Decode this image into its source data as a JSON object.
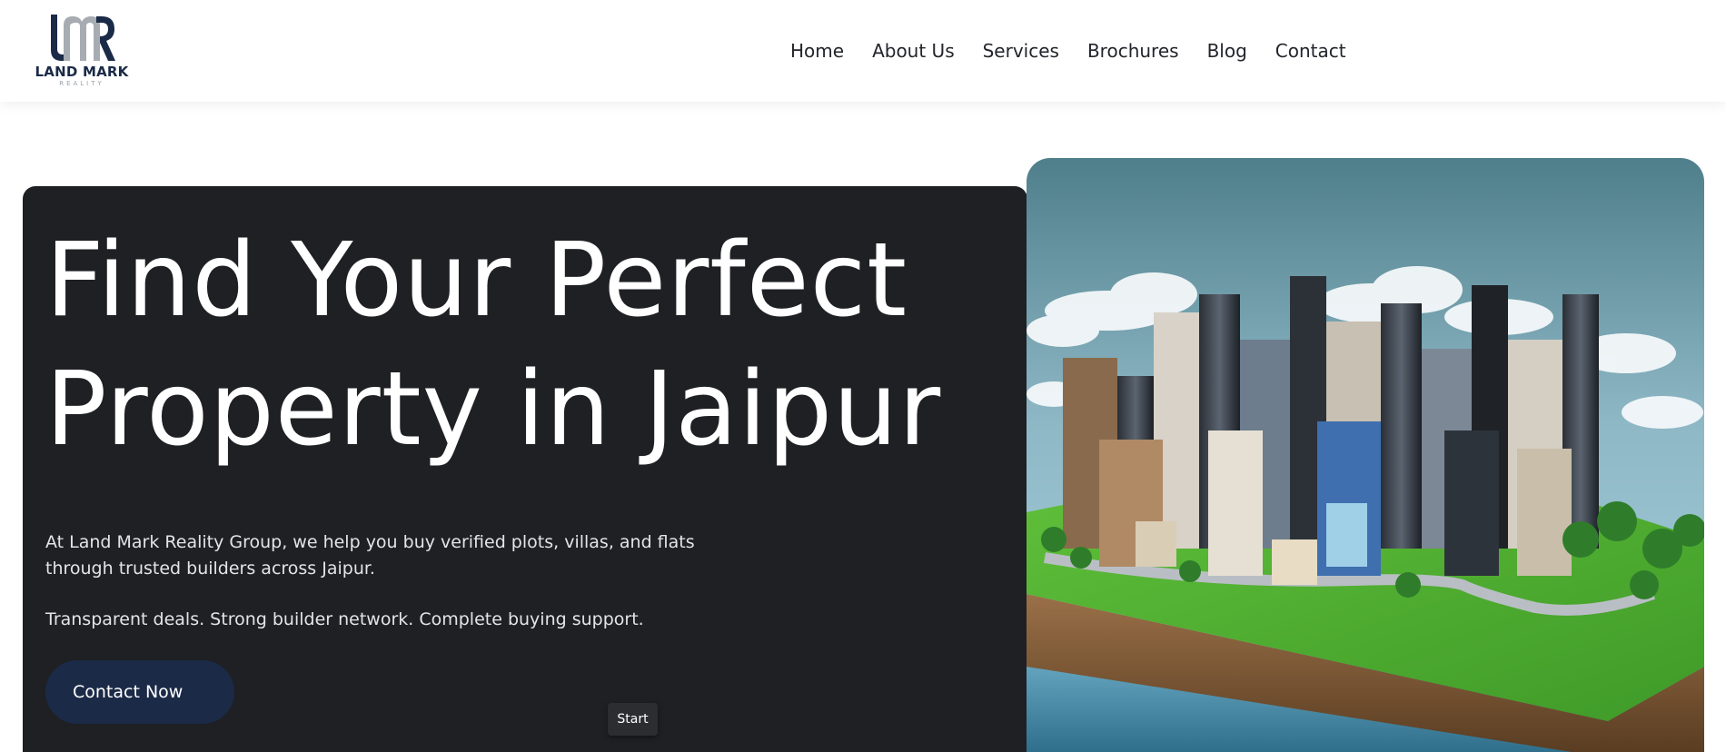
{
  "brand": {
    "monogram": "LMR",
    "name": "LAND MARK",
    "sub": "REALITY",
    "navy": "#1b2a47",
    "grey": "#a7acb3"
  },
  "nav": {
    "items": [
      {
        "label": "Home"
      },
      {
        "label": "About Us"
      },
      {
        "label": "Services"
      },
      {
        "label": "Brochures"
      },
      {
        "label": "Blog"
      },
      {
        "label": "Contact"
      }
    ]
  },
  "hero": {
    "title_line1": "Find Your Perfect",
    "title_line2": "Property in Jaipur",
    "description": "At Land Mark Reality Group, we help you buy verified plots, villas, and flats through trusted builders across Jaipur.",
    "tagline": "Transparent deals. Strong builder network. Complete buying support.",
    "cta_label": "Contact Now",
    "card_color": "#1f2024",
    "button_color": "#1b2a47",
    "image_icon": "city-island-image"
  },
  "tooltip": {
    "label": "Start"
  }
}
